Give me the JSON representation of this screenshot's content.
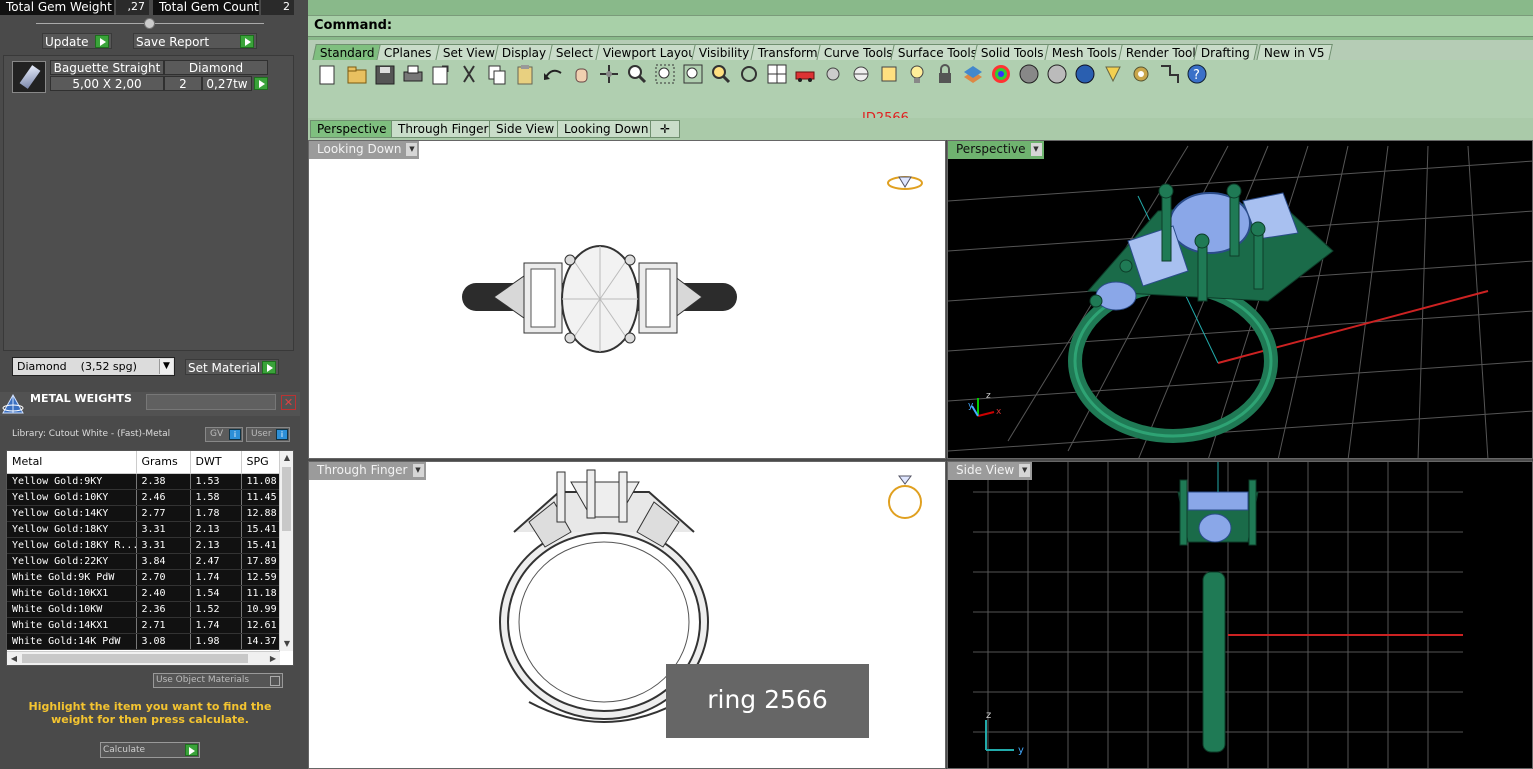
{
  "gem_summary": {
    "weight_label": "Total Gem Weight",
    "weight_value": ",27",
    "count_label": "Total Gem Count",
    "count_value": "2"
  },
  "actions": {
    "update": "Update",
    "save_report": "Save Report",
    "set_material": "Set Material",
    "calculate": "Calculate"
  },
  "gem": {
    "shape": "Baguette Straight",
    "material": "Diamond",
    "size": "5,00 X 2,00",
    "count": "2",
    "total_weight": "0,27tw"
  },
  "material_select": "Diamond    (3,52 spg)",
  "metal_weights": {
    "title": "METAL WEIGHTS",
    "library": "Library: Cutout White - (Fast)-Metal",
    "gv_label": "GV",
    "user_label": "User",
    "headers": [
      "Metal",
      "Grams",
      "DWT",
      "SPG"
    ],
    "rows": [
      [
        "Yellow Gold:9KY",
        "2.38",
        "1.53",
        "11.08"
      ],
      [
        "Yellow Gold:10KY",
        "2.46",
        "1.58",
        "11.45"
      ],
      [
        "Yellow Gold:14KY",
        "2.77",
        "1.78",
        "12.88"
      ],
      [
        "Yellow Gold:18KY",
        "3.31",
        "2.13",
        "15.41"
      ],
      [
        "Yellow Gold:18KY R...",
        "3.31",
        "2.13",
        "15.41"
      ],
      [
        "Yellow Gold:22KY",
        "3.84",
        "2.47",
        "17.89"
      ],
      [
        "White Gold:9K PdW",
        "2.70",
        "1.74",
        "12.59"
      ],
      [
        "White Gold:10KX1",
        "2.40",
        "1.54",
        "11.18"
      ],
      [
        "White Gold:10KW",
        "2.36",
        "1.52",
        "10.99"
      ],
      [
        "White Gold:14KX1",
        "2.71",
        "1.74",
        "12.61"
      ],
      [
        "White Gold:14K PdW",
        "3.08",
        "1.98",
        "14.37"
      ]
    ],
    "use_object_materials": "Use Object Materials",
    "hint": "Highlight the item you want to find the weight for then press calculate."
  },
  "command_label": "Command:",
  "toolbar_tabs": [
    "Standard",
    "CPlanes",
    "Set View",
    "Display",
    "Select",
    "Viewport Layout",
    "Visibility",
    "Transform",
    "Curve Tools",
    "Surface Tools",
    "Solid Tools",
    "Mesh Tools",
    "Render Tools",
    "Drafting",
    "New in V5"
  ],
  "model_id": "ID2566",
  "view_tabs": [
    "Perspective",
    "Through Finger",
    "Side View",
    "Looking Down"
  ],
  "viewports": {
    "top_left": "Looking Down",
    "top_right": "Perspective",
    "bottom_left": "Through Finger",
    "bottom_right": "Side View"
  },
  "ring_label": "ring 2566",
  "colors": {
    "accent_green": "#7fbf7f",
    "metal_green": "#1f7a55",
    "gem_blue": "#8aa7e8",
    "id_red": "#e02020",
    "hint_yellow": "#f4c430"
  }
}
